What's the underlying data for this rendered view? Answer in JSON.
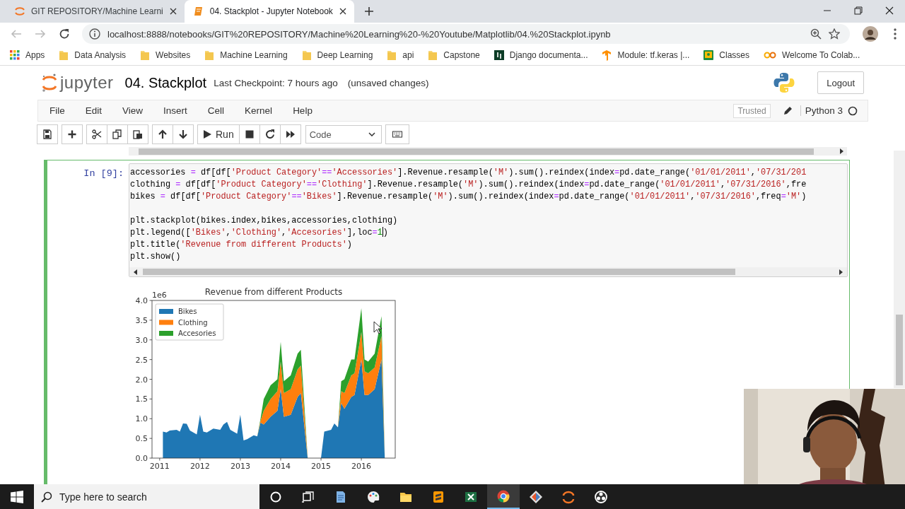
{
  "browser": {
    "tabs": [
      {
        "title": "GIT REPOSITORY/Machine Learni",
        "kind": "jupyter",
        "selected": false
      },
      {
        "title": "04. Stackplot - Jupyter Notebook",
        "kind": "notebook",
        "selected": true
      }
    ],
    "url": "localhost:8888/notebooks/GIT%20REPOSITORY/Machine%20Learning%20-%20Youtube/Matplotlib/04.%20Stackplot.ipynb",
    "bookmarks": [
      {
        "label": "Apps",
        "kind": "apps"
      },
      {
        "label": "Data Analysis",
        "kind": "folder"
      },
      {
        "label": "Websites",
        "kind": "folder"
      },
      {
        "label": "Machine Learning",
        "kind": "folder"
      },
      {
        "label": "Deep Learning",
        "kind": "folder"
      },
      {
        "label": "api",
        "kind": "folder"
      },
      {
        "label": "Capstone",
        "kind": "folder"
      },
      {
        "label": "Django documenta...",
        "kind": "django"
      },
      {
        "label": "Module: tf.keras  |...",
        "kind": "tensorflow"
      },
      {
        "label": "Classes",
        "kind": "classroom"
      },
      {
        "label": "Welcome To Colab...",
        "kind": "colab"
      }
    ]
  },
  "notebook": {
    "logo_text": "jupyter",
    "title": "04. Stackplot",
    "checkpoint": "Last Checkpoint: 7 hours ago",
    "autosave": "(unsaved changes)",
    "logout": "Logout",
    "menu": [
      "File",
      "Edit",
      "View",
      "Insert",
      "Cell",
      "Kernel",
      "Help"
    ],
    "trusted": "Trusted",
    "kernel": "Python 3",
    "run": "Run",
    "cell_type": "Code"
  },
  "cell": {
    "prompt": "In [9]:",
    "lines": [
      {
        "kind": "code",
        "tokens": [
          {
            "kind": "plain",
            "text": "accessories "
          },
          {
            "kind": "operator",
            "text": "="
          },
          {
            "kind": "plain",
            "text": " df[df["
          },
          {
            "kind": "string",
            "text": "'Product Category'"
          },
          {
            "kind": "operator",
            "text": "=="
          },
          {
            "kind": "string",
            "text": "'Accessories'"
          },
          {
            "kind": "plain",
            "text": "].Revenue.resample("
          },
          {
            "kind": "string",
            "text": "'M'"
          },
          {
            "kind": "plain",
            "text": ").sum().reindex(index"
          },
          {
            "kind": "operator",
            "text": "="
          },
          {
            "kind": "plain",
            "text": "pd.date_range("
          },
          {
            "kind": "string",
            "text": "'01/01/2011'"
          },
          {
            "kind": "plain",
            "text": ","
          },
          {
            "kind": "string",
            "text": "'07/31/201"
          }
        ]
      },
      {
        "kind": "code",
        "tokens": [
          {
            "kind": "plain",
            "text": "clothing "
          },
          {
            "kind": "operator",
            "text": "="
          },
          {
            "kind": "plain",
            "text": " df[df["
          },
          {
            "kind": "string",
            "text": "'Product Category'"
          },
          {
            "kind": "operator",
            "text": "=="
          },
          {
            "kind": "string",
            "text": "'Clothing'"
          },
          {
            "kind": "plain",
            "text": "].Revenue.resample("
          },
          {
            "kind": "string",
            "text": "'M'"
          },
          {
            "kind": "plain",
            "text": ").sum().reindex(index"
          },
          {
            "kind": "operator",
            "text": "="
          },
          {
            "kind": "plain",
            "text": "pd.date_range("
          },
          {
            "kind": "string",
            "text": "'01/01/2011'"
          },
          {
            "kind": "plain",
            "text": ","
          },
          {
            "kind": "string",
            "text": "'07/31/2016'"
          },
          {
            "kind": "plain",
            "text": ",fre"
          }
        ]
      },
      {
        "kind": "code",
        "tokens": [
          {
            "kind": "plain",
            "text": "bikes "
          },
          {
            "kind": "operator",
            "text": "="
          },
          {
            "kind": "plain",
            "text": " df[df["
          },
          {
            "kind": "string",
            "text": "'Product Category'"
          },
          {
            "kind": "operator",
            "text": "=="
          },
          {
            "kind": "string",
            "text": "'Bikes'"
          },
          {
            "kind": "plain",
            "text": "].Revenue.resample("
          },
          {
            "kind": "string",
            "text": "'M'"
          },
          {
            "kind": "plain",
            "text": ").sum().reindex(index"
          },
          {
            "kind": "operator",
            "text": "="
          },
          {
            "kind": "plain",
            "text": "pd.date_range("
          },
          {
            "kind": "string",
            "text": "'01/01/2011'"
          },
          {
            "kind": "plain",
            "text": ","
          },
          {
            "kind": "string",
            "text": "'07/31/2016'"
          },
          {
            "kind": "plain",
            "text": ",freq"
          },
          {
            "kind": "operator",
            "text": "="
          },
          {
            "kind": "string",
            "text": "'M'"
          },
          {
            "kind": "plain",
            "text": ")"
          }
        ]
      },
      {
        "kind": "blank"
      },
      {
        "kind": "code",
        "tokens": [
          {
            "kind": "plain",
            "text": "plt.stackplot(bikes.index,bikes,accessories,clothing)"
          }
        ]
      },
      {
        "kind": "code",
        "tokens": [
          {
            "kind": "plain",
            "text": "plt.legend(["
          },
          {
            "kind": "string",
            "text": "'Bikes'"
          },
          {
            "kind": "plain",
            "text": ","
          },
          {
            "kind": "string",
            "text": "'Clothing'"
          },
          {
            "kind": "plain",
            "text": ","
          },
          {
            "kind": "string",
            "text": "'Accesories'"
          },
          {
            "kind": "plain",
            "text": "],loc"
          },
          {
            "kind": "operator",
            "text": "="
          },
          {
            "kind": "number",
            "text": "1",
            "cursor": true
          },
          {
            "kind": "plain",
            "text": ")"
          }
        ]
      },
      {
        "kind": "code",
        "tokens": [
          {
            "kind": "plain",
            "text": "plt.title("
          },
          {
            "kind": "string",
            "text": "'Revenue from different Products'"
          },
          {
            "kind": "plain",
            "text": ")"
          }
        ]
      },
      {
        "kind": "code",
        "tokens": [
          {
            "kind": "plain",
            "text": "plt.show()"
          }
        ]
      }
    ]
  },
  "output": {
    "chart_data": {
      "type": "area",
      "title": "Revenue from different Products",
      "stacked": true,
      "x": [
        2011.08,
        2011.17,
        2011.25,
        2011.42,
        2011.5,
        2011.58,
        2011.67,
        2011.75,
        2011.92,
        2012.0,
        2012.08,
        2012.17,
        2012.33,
        2012.5,
        2012.58,
        2012.67,
        2012.75,
        2012.92,
        2013.0,
        2013.08,
        2013.17,
        2013.33,
        2013.42,
        2013.5,
        2013.58,
        2013.75,
        2013.92,
        2014.0,
        2014.08,
        2014.25,
        2014.42,
        2014.5,
        2014.67,
        2015.0,
        2015.08,
        2015.25,
        2015.33,
        2015.42,
        2015.5,
        2015.58,
        2015.75,
        2015.83,
        2016.0,
        2016.08,
        2016.17,
        2016.33,
        2016.5,
        2016.58
      ],
      "series": [
        {
          "name": "Bikes",
          "color": "#1f77b4",
          "values": [
            0.67,
            0.65,
            0.7,
            0.72,
            0.67,
            0.88,
            0.87,
            0.7,
            0.6,
            1.1,
            0.67,
            0.65,
            0.75,
            0.72,
            0.85,
            0.92,
            0.72,
            0.62,
            1.1,
            0.45,
            0.48,
            0.58,
            0.55,
            0.9,
            0.85,
            1.05,
            1.2,
            1.75,
            1.05,
            1.1,
            1.55,
            1.65,
            0,
            0,
            0.67,
            0.72,
            0.88,
            0.78,
            1.4,
            1.25,
            1.55,
            1.6,
            2.5,
            1.6,
            1.6,
            1.75,
            2.5,
            0
          ]
        },
        {
          "name": "Clothing",
          "color": "#ff7f0e",
          "values": [
            0,
            0,
            0,
            0,
            0,
            0,
            0,
            0,
            0,
            0,
            0,
            0,
            0,
            0,
            0,
            0,
            0,
            0,
            0,
            0,
            0,
            0,
            0,
            0.05,
            0.35,
            0.45,
            0.5,
            0.7,
            0.6,
            0.65,
            0.7,
            0.7,
            0,
            0,
            0,
            0,
            0,
            0,
            0.3,
            0.4,
            0.55,
            0.55,
            0.7,
            0.6,
            0.55,
            0.55,
            0.6,
            0
          ]
        },
        {
          "name": "Accesories",
          "color": "#2ca02c",
          "values": [
            0,
            0,
            0,
            0,
            0,
            0,
            0,
            0,
            0,
            0,
            0,
            0,
            0,
            0,
            0,
            0,
            0,
            0,
            0,
            0,
            0,
            0,
            0,
            0.05,
            0.3,
            0.35,
            0.3,
            0.5,
            0.3,
            0.35,
            0.4,
            0.4,
            0,
            0,
            0,
            0,
            0,
            0,
            0.25,
            0.35,
            0.4,
            0.35,
            0.6,
            0.3,
            0.3,
            0.35,
            0.5,
            0
          ]
        }
      ],
      "xlim": [
        2010.81,
        2016.84
      ],
      "ylim": [
        0,
        4.0
      ],
      "xticks": [
        2011,
        2012,
        2013,
        2014,
        2015,
        2016
      ],
      "yticks": [
        {
          "value": 0,
          "label": "0.0"
        },
        {
          "value": 0.5,
          "label": "0.5"
        },
        {
          "value": 1,
          "label": "1.0"
        },
        {
          "value": 1.5,
          "label": "1.5"
        },
        {
          "value": 2,
          "label": "2.0"
        },
        {
          "value": 2.5,
          "label": "2.5"
        },
        {
          "value": 3,
          "label": "3.0"
        },
        {
          "value": 3.5,
          "label": "3.5"
        },
        {
          "value": 4,
          "label": "4.0"
        }
      ],
      "annotations": [
        "1e6"
      ],
      "legend": "upper left"
    }
  },
  "taskbar": {
    "search_placeholder": "Type here to search",
    "apps": [
      {
        "kind": "circle",
        "active": false
      },
      {
        "kind": "taskview",
        "active": false
      },
      {
        "kind": "document",
        "active": false
      },
      {
        "kind": "palette",
        "active": false
      },
      {
        "kind": "folder",
        "active": false
      },
      {
        "kind": "editor",
        "active": false
      },
      {
        "kind": "spreadsheet",
        "active": false
      },
      {
        "kind": "browser",
        "active": true
      },
      {
        "kind": "diamond",
        "active": false
      },
      {
        "kind": "jupyter",
        "active": false
      },
      {
        "kind": "aperture",
        "active": false
      }
    ]
  }
}
